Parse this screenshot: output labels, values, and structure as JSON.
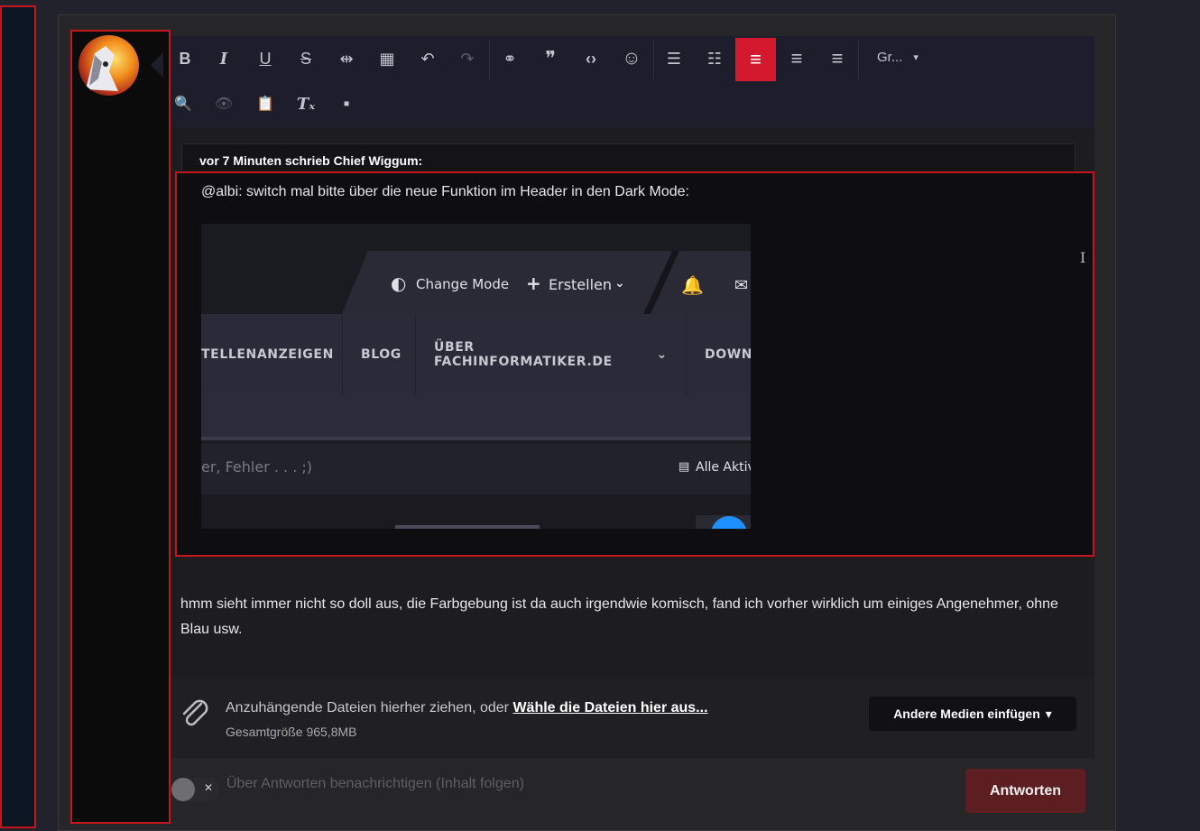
{
  "toolbar": {
    "buttons": [
      {
        "name": "bold-button",
        "glyph": "B"
      },
      {
        "name": "italic-button",
        "glyph": "I"
      },
      {
        "name": "underline-button",
        "glyph": "U"
      },
      {
        "name": "strikethrough-button",
        "glyph": "S"
      },
      {
        "name": "spoiler-button",
        "glyph": "⇹"
      },
      {
        "name": "table-button",
        "glyph": "▦"
      },
      {
        "name": "undo-button",
        "glyph": "↶"
      },
      {
        "name": "redo-button",
        "glyph": "↷"
      },
      {
        "name": "link-button",
        "glyph": "⚭"
      },
      {
        "name": "quote-button",
        "glyph": "❞"
      },
      {
        "name": "code-button",
        "glyph": "‹›"
      },
      {
        "name": "emoji-button",
        "glyph": "☺"
      },
      {
        "name": "bullet-list-button",
        "glyph": "☰"
      },
      {
        "name": "numbered-list-button",
        "glyph": "☷"
      },
      {
        "name": "align-left-button",
        "glyph": "≡"
      },
      {
        "name": "align-center-button",
        "glyph": "≡"
      },
      {
        "name": "align-right-button",
        "glyph": "≡"
      }
    ],
    "row2": [
      {
        "name": "preview-button",
        "glyph": "🔍"
      },
      {
        "name": "view-button",
        "glyph": "👁"
      },
      {
        "name": "paste-button",
        "glyph": "📋"
      },
      {
        "name": "clear-format-button",
        "glyph": "Tₓ"
      },
      {
        "name": "source-button",
        "glyph": "▪"
      }
    ],
    "font_size_label": "Gr...",
    "dropdown_arrow": "▾"
  },
  "quote": {
    "author_line": "vor 7 Minuten schrieb Chief Wiggum:",
    "text": "@albi: switch mal bitte über die neue Funktion im Header in den Dark Mode:"
  },
  "embedded_screenshot": {
    "change_mode": "Change Mode",
    "create": "Erstellen",
    "nav_items": [
      "TELLENANZEIGEN",
      "BLOG",
      "ÜBER FACHINFORMATIKER.DE",
      "DOWN"
    ],
    "search_placeholder": "er, Fehler . . . ;)",
    "all_activity": "Alle Aktiv"
  },
  "reply": {
    "text": "hmm sieht immer nicht so doll aus, die Farbgebung ist da auch irgendwie komisch, fand ich vorher wirklich um einiges Angenehmer, ohne Blau usw."
  },
  "attachments": {
    "prompt": "Anzuhängende Dateien hierher ziehen, oder ",
    "link": "Wähle die Dateien hier aus...",
    "total_size": "Gesamtgröße 965,8MB",
    "media_button": "Andere Medien einfügen",
    "media_caret": "▾"
  },
  "footer": {
    "notify_label": "Über Antworten benachrichtigen (Inhalt folgen)",
    "toggle_x": "✕",
    "submit": "Antworten"
  },
  "colors": {
    "accent": "#d4182d",
    "submit_bg": "#5d1e22",
    "highlight_border": "#c4161c"
  }
}
